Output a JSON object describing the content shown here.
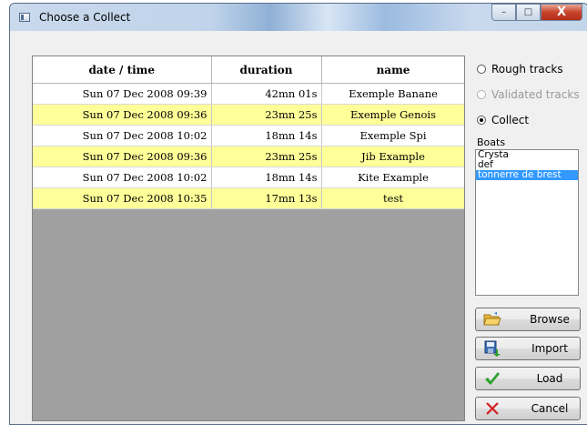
{
  "window": {
    "title": "Choose a Collect",
    "controls": {
      "minimize": "–",
      "maximize": "□",
      "close": "X"
    }
  },
  "table": {
    "columns": [
      "date / time",
      "duration",
      "name"
    ],
    "rows": [
      {
        "date": "Sun 07 Dec 2008 09:39",
        "duration": "42mn 01s",
        "name": "Exemple Banane",
        "highlight": false
      },
      {
        "date": "Sun 07 Dec 2008 09:36",
        "duration": "23mn 25s",
        "name": "Exemple Genois",
        "highlight": true
      },
      {
        "date": "Sun 07 Dec 2008 10:02",
        "duration": "18mn 14s",
        "name": "Exemple Spi",
        "highlight": false
      },
      {
        "date": "Sun 07 Dec 2008 09:36",
        "duration": "23mn 25s",
        "name": "Jib Example",
        "highlight": true
      },
      {
        "date": "Sun 07 Dec 2008 10:02",
        "duration": "18mn 14s",
        "name": "Kite Example",
        "highlight": false
      },
      {
        "date": "Sun 07 Dec 2008 10:35",
        "duration": "17mn 13s",
        "name": "test",
        "highlight": true
      }
    ]
  },
  "options": {
    "rough_tracks": "Rough tracks",
    "validated_tracks": "Validated tracks",
    "collect": "Collect",
    "selected": "collect"
  },
  "boats": {
    "label": "Boats",
    "items": [
      "Crysta",
      "def",
      "tonnerre de brest"
    ],
    "selected_index": 2
  },
  "buttons": {
    "browse": "Browse",
    "import": "Import",
    "load": "Load",
    "cancel": "Cancel"
  },
  "colors": {
    "row_highlight": "#ffff99",
    "grid_empty": "#a0a0a0",
    "selection": "#3399ff",
    "load_icon": "#2ea02e",
    "cancel_icon": "#d21e1e"
  }
}
